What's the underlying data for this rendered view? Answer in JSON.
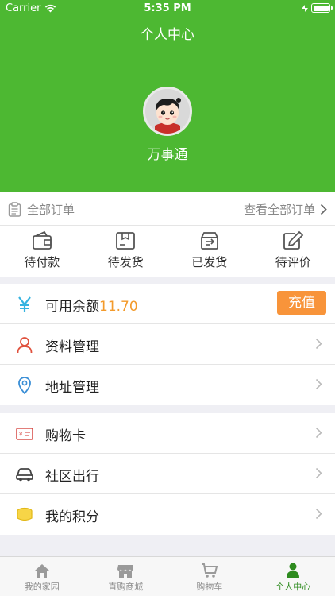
{
  "status_bar": {
    "carrier": "Carrier",
    "time": "5:35 PM"
  },
  "nav": {
    "title": "个人中心"
  },
  "profile": {
    "username": "万事通"
  },
  "orders": {
    "header_label": "全部订单",
    "view_all_label": "查看全部订单",
    "items": [
      {
        "label": "待付款",
        "icon": "wallet-icon"
      },
      {
        "label": "待发货",
        "icon": "box-icon"
      },
      {
        "label": "已发货",
        "icon": "shipped-icon"
      },
      {
        "label": "待评价",
        "icon": "edit-icon"
      }
    ]
  },
  "account": {
    "balance_label": "可用余额",
    "balance_amount": "11.70",
    "recharge_label": "充值",
    "profile_label": "资料管理",
    "address_label": "地址管理"
  },
  "services": {
    "card_label": "购物卡",
    "travel_label": "社区出行",
    "points_label": "我的积分"
  },
  "tabs": [
    {
      "label": "我的家园",
      "icon": "home-icon",
      "active": false
    },
    {
      "label": "直购商城",
      "icon": "store-icon",
      "active": false
    },
    {
      "label": "购物车",
      "icon": "cart-icon",
      "active": false
    },
    {
      "label": "个人中心",
      "icon": "person-icon",
      "active": true
    }
  ],
  "colors": {
    "brand_green": "#4db832",
    "accent_orange": "#f8943a",
    "amount_orange": "#f39a2b",
    "active_tab": "#2e8b1f"
  }
}
